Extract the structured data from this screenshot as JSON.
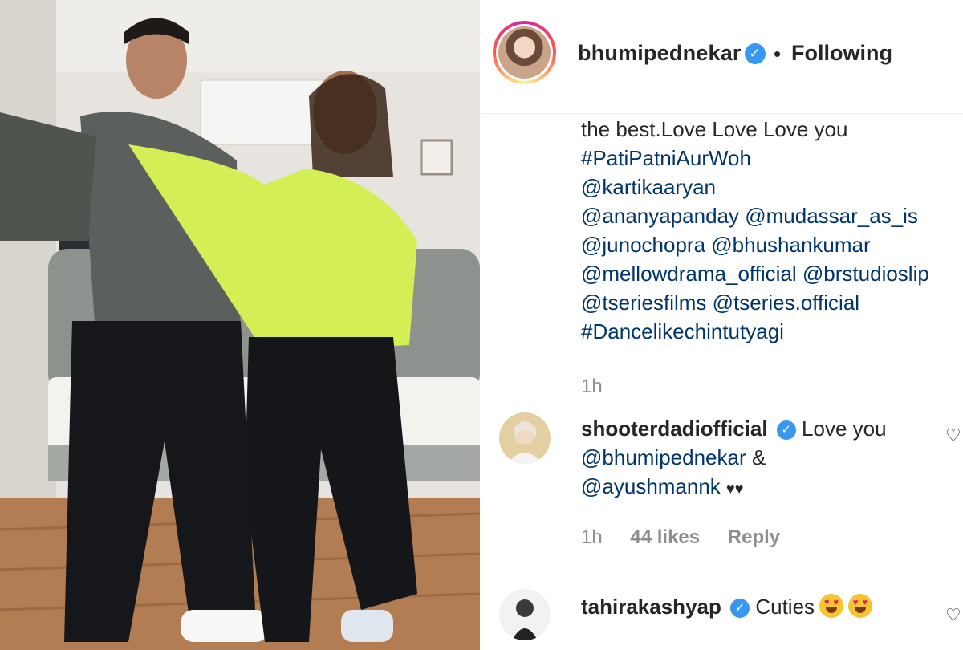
{
  "post": {
    "author": "bhumipednekar",
    "separator": "•",
    "follow_status": "Following"
  },
  "caption": {
    "partial_line": "the best.Love Love Love you",
    "lines": [
      "#PatiPatniAurWoh",
      "@kartikaaryan",
      "@ananyapanday @mudassar_as_is",
      "@junochopra @bhushankumar",
      "@mellowdrama_official @brstudioslip",
      "@tseriesfilms @tseries.official",
      "#Dancelikechintutyagi"
    ],
    "time": "1h"
  },
  "comments": [
    {
      "user": "shooterdadiofficial",
      "text": "Love you",
      "mention1": "@bhumipednekar",
      "amp": "&",
      "mention2": "@ayushmannk",
      "hearts": "♥♥",
      "time": "1h",
      "likes": "44 likes",
      "reply": "Reply"
    },
    {
      "user": "tahirakashyap",
      "text": "Cuties",
      "emoji_icon": "heart-eyes-emoji"
    }
  ],
  "icons": {
    "verified": "verified-badge-icon",
    "like": "heart-outline-icon"
  },
  "colors": {
    "link": "#003569",
    "muted": "#8e8e8e",
    "verified": "#3897f0",
    "jacket": "#d4ee55"
  }
}
